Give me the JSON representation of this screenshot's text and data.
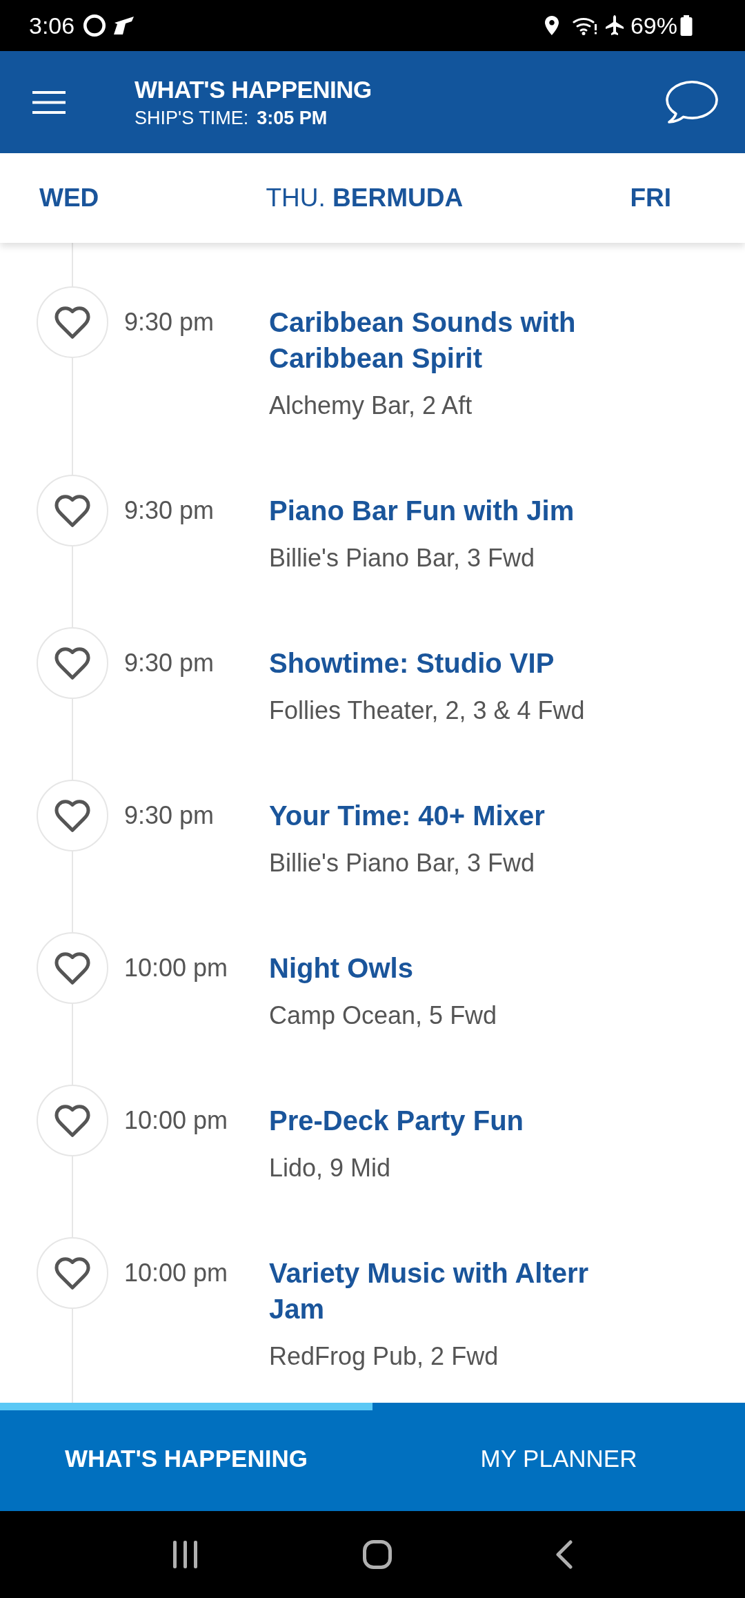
{
  "status_bar": {
    "time": "3:06",
    "battery": "69%"
  },
  "header": {
    "title": "WHAT'S HAPPENING",
    "ship_time_label": "SHIP'S TIME:",
    "ship_time": "3:05 PM"
  },
  "day_tabs": [
    {
      "label": "WED",
      "selected": false
    },
    {
      "label": "THU. **BERMUDA**",
      "selected": true
    },
    {
      "label": "FRI",
      "selected": false
    }
  ],
  "events": [
    {
      "time": "9:30 pm",
      "title": "Caribbean Sounds with Caribbean Spirit",
      "location": "Alchemy Bar, 2 Aft",
      "favorite": false
    },
    {
      "time": "9:30 pm",
      "title": "Piano Bar Fun with Jim",
      "location": "Billie's Piano Bar, 3 Fwd",
      "favorite": false
    },
    {
      "time": "9:30 pm",
      "title": "Showtime: Studio VIP",
      "location": "Follies Theater, 2, 3 & 4 Fwd",
      "favorite": false
    },
    {
      "time": "9:30 pm",
      "title": "Your Time: 40+ Mixer",
      "location": "Billie's Piano Bar, 3 Fwd",
      "favorite": false
    },
    {
      "time": "10:00 pm",
      "title": "Night Owls",
      "location": "Camp Ocean, 5 Fwd",
      "favorite": false
    },
    {
      "time": "10:00 pm",
      "title": "Pre-Deck Party Fun",
      "location": "Lido, 9 Mid",
      "favorite": false
    },
    {
      "time": "10:00 pm",
      "title": "Variety Music with Alterr Jam",
      "location": "RedFrog Pub, 2 Fwd",
      "favorite": false
    }
  ],
  "bottom_tabs": [
    {
      "label": "WHAT'S HAPPENING",
      "selected": true
    },
    {
      "label": "MY PLANNER",
      "selected": false
    }
  ]
}
